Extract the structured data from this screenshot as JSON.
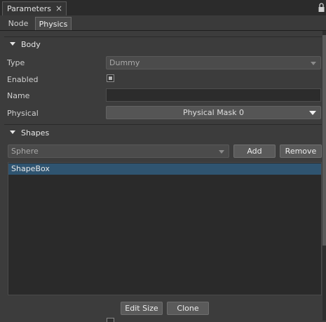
{
  "window": {
    "tab_title": "Parameters",
    "close_glyph": "×",
    "lock_icon": "lock-icon"
  },
  "subtabs": [
    {
      "label": "Node"
    },
    {
      "label": "Physics",
      "active": true
    }
  ],
  "body": {
    "header": "Body",
    "type_label": "Type",
    "type_value": "Dummy",
    "enabled_label": "Enabled",
    "enabled_checked": true,
    "name_label": "Name",
    "name_value": "",
    "physical_label": "Physical",
    "physical_value": "Physical Mask 0"
  },
  "shapes": {
    "header": "Shapes",
    "shape_type": "Sphere",
    "add_label": "Add",
    "remove_label": "Remove",
    "items": [
      {
        "label": "ShapeBox",
        "selected": true
      }
    ],
    "edit_size_label": "Edit Size",
    "clone_label": "Clone"
  },
  "colors": {
    "background": "#3c3c3c",
    "selection": "#2f5470",
    "list_bg": "#2a2a2a"
  }
}
